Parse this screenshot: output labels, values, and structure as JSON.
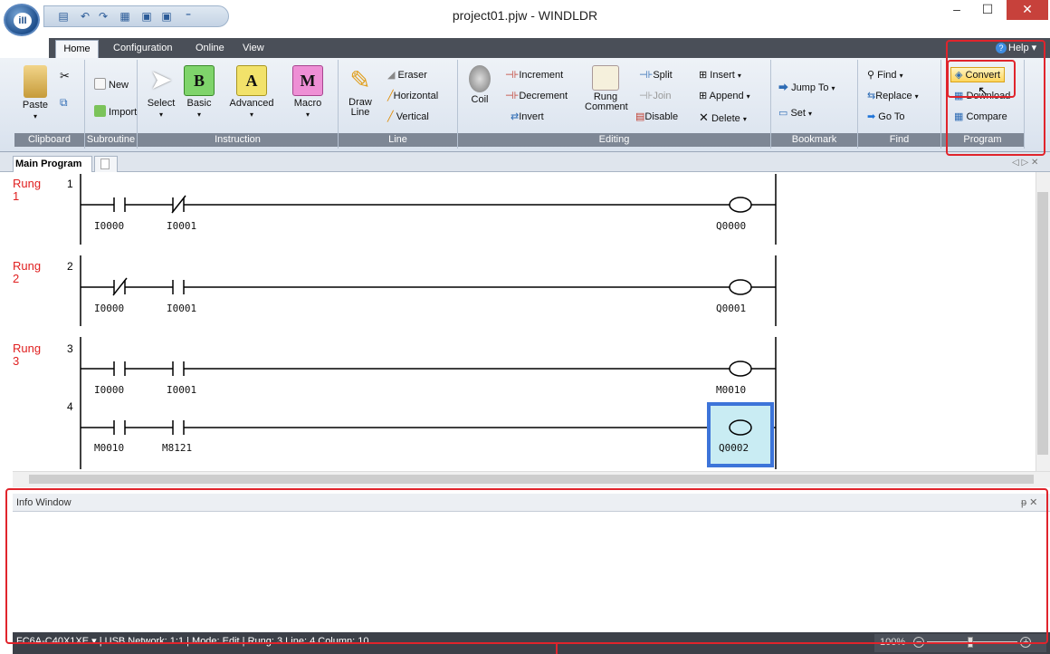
{
  "window": {
    "title": "project01.pjw - WINDLDR",
    "minimize": "–",
    "maximize": "☐",
    "close": "✕"
  },
  "app_orb": {
    "label": "iII"
  },
  "tabs": [
    {
      "label": "Home"
    },
    {
      "label": "Configuration"
    },
    {
      "label": "Online"
    },
    {
      "label": "View"
    }
  ],
  "help": {
    "label": "Help"
  },
  "ribbon": {
    "clipboard": {
      "group": "Clipboard",
      "paste": "Paste"
    },
    "subroutine": {
      "group": "Subroutine",
      "new": "New",
      "import": "Import"
    },
    "instruction": {
      "group": "Instruction",
      "select": "Select",
      "basic": "Basic",
      "advanced": "Advanced",
      "macro": "Macro",
      "basic_glyph": "B",
      "advanced_glyph": "A",
      "macro_glyph": "M"
    },
    "line": {
      "group": "Line",
      "draw_line": "Draw\nLine",
      "eraser": "Eraser",
      "horizontal": "Horizontal",
      "vertical": "Vertical"
    },
    "editing": {
      "group": "Editing",
      "coil": "Coil",
      "increment": "Increment",
      "decrement": "Decrement",
      "invert": "Invert",
      "rung_comment": "Rung\nComment",
      "split": "Split",
      "join": "Join",
      "disable": "Disable",
      "insert": "Insert",
      "append": "Append",
      "delete": "Delete"
    },
    "bookmark": {
      "group": "Bookmark",
      "jump_to": "Jump To",
      "set": "Set"
    },
    "find": {
      "group": "Find",
      "find": "Find",
      "replace": "Replace",
      "go_to": "Go To"
    },
    "program": {
      "group": "Program",
      "convert": "Convert",
      "download": "Download",
      "compare": "Compare"
    }
  },
  "doc_tabs": {
    "main": "Main Program",
    "arrows": "◁ ▷ ✕"
  },
  "ladder": {
    "rung_word": "Rung",
    "rungs": [
      {
        "label_num": "1",
        "line": "1",
        "contacts": [
          "I0000",
          "I0001"
        ],
        "coil": "Q0000"
      },
      {
        "label_num": "2",
        "line": "2",
        "contacts": [
          "I0000",
          "I0001"
        ],
        "coil": "Q0001"
      },
      {
        "label_num": "3",
        "line": "3",
        "contacts": [
          "I0000",
          "I0001"
        ],
        "coil": "M0010"
      },
      {
        "label_num": "",
        "line": "4",
        "contacts": [
          "M0010",
          "M8121"
        ],
        "coil": "Q0002"
      }
    ]
  },
  "info_window": {
    "title": "Info Window",
    "pin": "ᵽ ✕"
  },
  "status": {
    "text": "FC6A-C40X1XE ▾ | USB  Network: 1:1 | Mode: Edit | Rung: 3  Line: 4  Column: 10",
    "zoom": "100%"
  },
  "colors": {
    "rung_red": "#e02020",
    "selection_blue": "#3d74d9",
    "selection_fill": "#c9ecf3",
    "highlight_red": "#e0242c"
  }
}
